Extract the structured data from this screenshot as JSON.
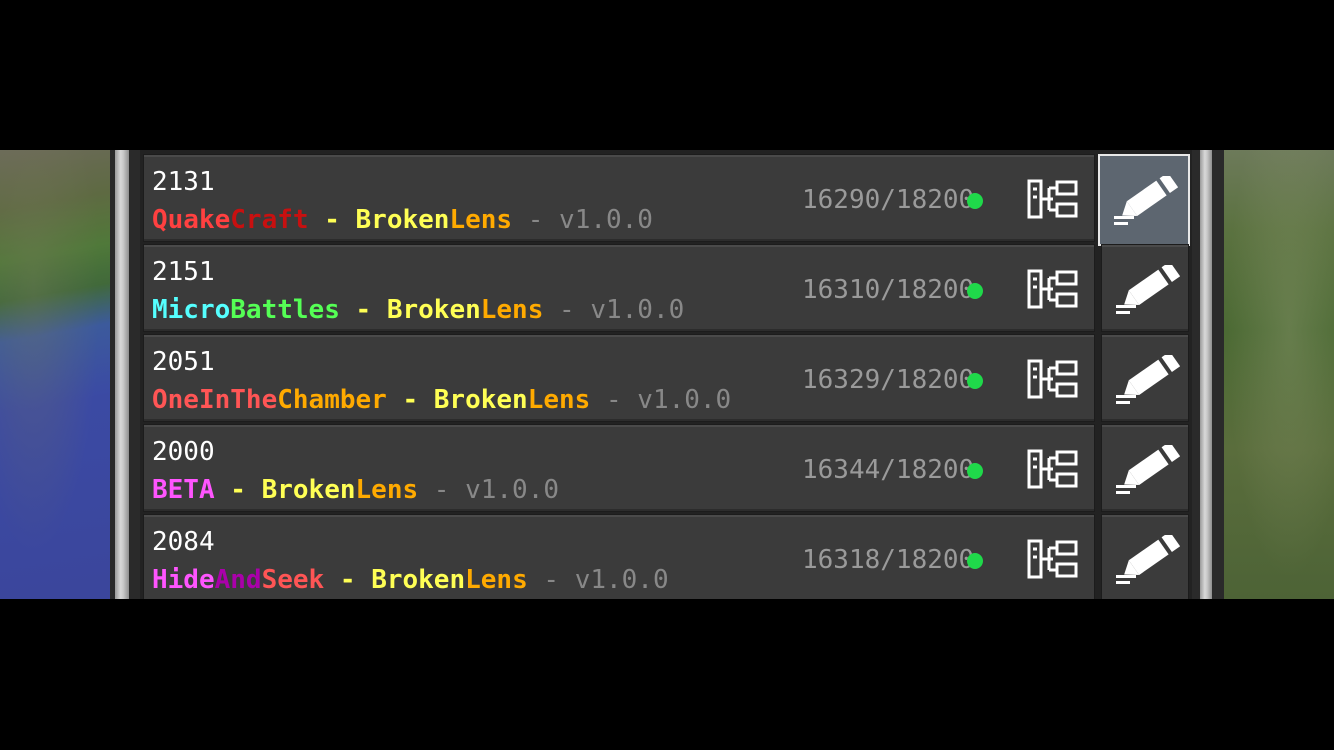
{
  "servers": [
    {
      "ping": "2131",
      "name_parts": [
        {
          "text": "Quake",
          "color": "#ff4040"
        },
        {
          "text": "Craft",
          "color": "#c81010"
        }
      ],
      "separator": " - ",
      "author_parts": [
        {
          "text": "Broken",
          "color": "#ffff55"
        },
        {
          "text": "Lens",
          "color": "#ffaa00"
        }
      ],
      "version": " - v1.0.0",
      "players": "16290/18200",
      "status_color": "#1fd94a",
      "selected": true
    },
    {
      "ping": "2151",
      "name_parts": [
        {
          "text": "Micro",
          "color": "#55ffff"
        },
        {
          "text": "Battles",
          "color": "#55ff55"
        }
      ],
      "separator": " - ",
      "author_parts": [
        {
          "text": "Broken",
          "color": "#ffff55"
        },
        {
          "text": "Lens",
          "color": "#ffaa00"
        }
      ],
      "version": " - v1.0.0",
      "players": "16310/18200",
      "status_color": "#1fd94a",
      "selected": false
    },
    {
      "ping": "2051",
      "name_parts": [
        {
          "text": "OneInThe",
          "color": "#ff5555"
        },
        {
          "text": "Chamber",
          "color": "#ffaa00"
        }
      ],
      "separator": " - ",
      "author_parts": [
        {
          "text": "Broken",
          "color": "#ffff55"
        },
        {
          "text": "Lens",
          "color": "#ffaa00"
        }
      ],
      "version": " - v1.0.0",
      "players": "16329/18200",
      "status_color": "#1fd94a",
      "selected": false
    },
    {
      "ping": "2000",
      "name_parts": [
        {
          "text": "BETA",
          "color": "#ff55ff"
        }
      ],
      "separator": " - ",
      "author_parts": [
        {
          "text": "Broken",
          "color": "#ffff55"
        },
        {
          "text": "Lens",
          "color": "#ffaa00"
        }
      ],
      "version": " - v1.0.0",
      "players": "16344/18200",
      "status_color": "#1fd94a",
      "selected": false
    },
    {
      "ping": "2084",
      "name_parts": [
        {
          "text": "Hide",
          "color": "#ff55ff"
        },
        {
          "text": "And",
          "color": "#aa00aa"
        },
        {
          "text": "Seek",
          "color": "#ff5555"
        }
      ],
      "separator": " - ",
      "author_parts": [
        {
          "text": "Broken",
          "color": "#ffff55"
        },
        {
          "text": "Lens",
          "color": "#ffaa00"
        }
      ],
      "version": " - v1.0.0",
      "players": "16318/18200",
      "status_color": "#1fd94a",
      "selected": false
    }
  ],
  "icons": {
    "tree": "server-tree-icon",
    "edit": "pencil-edit-icon"
  },
  "colors": {
    "separator": "#ffff55",
    "version": "#888888",
    "selected_button_bg": "#5d6670"
  }
}
